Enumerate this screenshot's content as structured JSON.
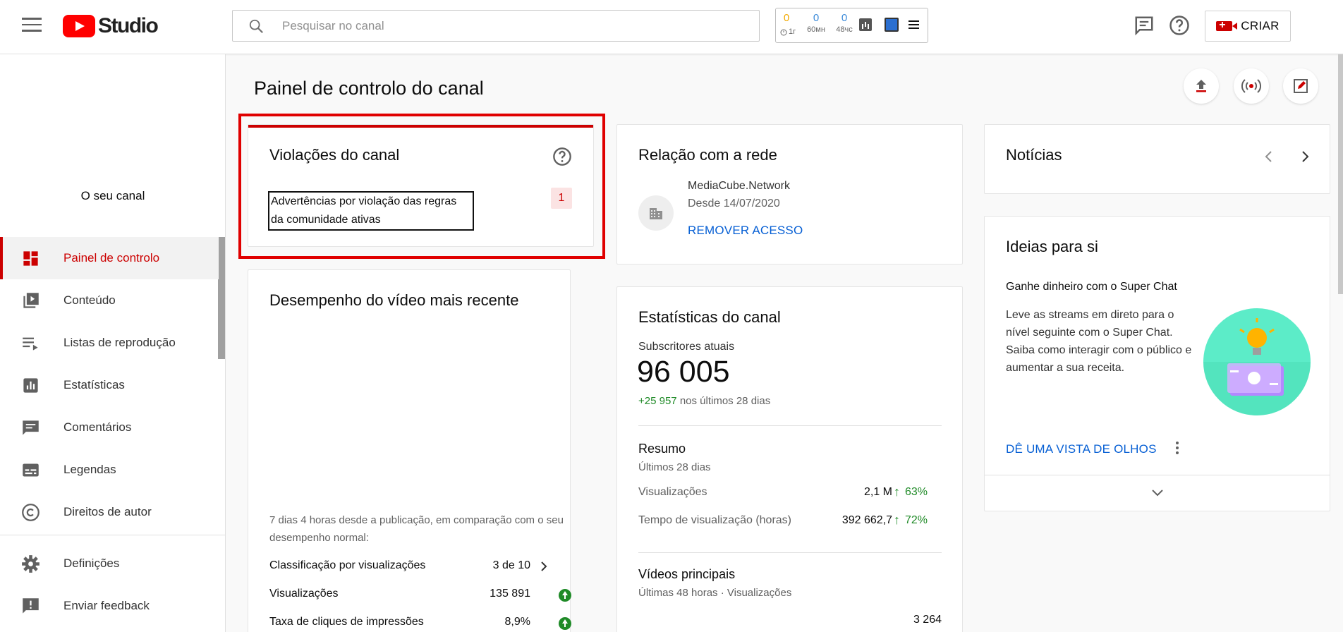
{
  "header": {
    "logo_text": "Studio",
    "search_placeholder": "Pesquisar no canal",
    "extension": {
      "counters": [
        {
          "value": "0",
          "label": "1г",
          "color": "#f2a900"
        },
        {
          "value": "0",
          "label": "60мн",
          "color": "#3b8ad9"
        },
        {
          "value": "0",
          "label": "48чс",
          "color": "#3b8ad9"
        }
      ]
    },
    "create_label": "CRIAR"
  },
  "sidebar": {
    "channel_label": "O seu canal",
    "items": [
      {
        "label": "Painel de controlo",
        "icon": "dashboard-icon",
        "active": true
      },
      {
        "label": "Conteúdo",
        "icon": "content-icon"
      },
      {
        "label": "Listas de reprodução",
        "icon": "playlists-icon"
      },
      {
        "label": "Estatísticas",
        "icon": "analytics-icon"
      },
      {
        "label": "Comentários",
        "icon": "comments-icon"
      },
      {
        "label": "Legendas",
        "icon": "subtitles-icon"
      },
      {
        "label": "Direitos de autor",
        "icon": "copyright-icon"
      },
      {
        "label": "Definições",
        "icon": "gear-icon"
      },
      {
        "label": "Enviar feedback",
        "icon": "feedback-icon"
      }
    ]
  },
  "main": {
    "page_title": "Painel de controlo do canal",
    "violations": {
      "title": "Violações do canal",
      "link_text": "Advertências por violação das regras da comunidade ativas",
      "count": "1"
    },
    "performance": {
      "title": "Desempenho do vídeo mais recente",
      "comparison_text": "7 dias 4 horas desde a publicação, em comparação com o seu desempenho normal:",
      "rows": [
        {
          "label": "Classificação por visualizações",
          "value": "3 de 10"
        },
        {
          "label": "Visualizações",
          "value": "135 891"
        },
        {
          "label": "Taxa de cliques de impressões",
          "value": "8,9%"
        }
      ]
    },
    "network": {
      "title": "Relação com a rede",
      "name": "MediaCube.Network",
      "since": "Desde 14/07/2020",
      "remove_label": "REMOVER ACESSO"
    },
    "stats": {
      "title": "Estatísticas do canal",
      "subs_label": "Subscritores atuais",
      "subs_value": "96 005",
      "subs_delta": "+25 957",
      "subs_delta_suffix": "nos últimos 28 dias",
      "summary_title": "Resumo",
      "summary_period": "Últimos 28 dias",
      "summary_rows": [
        {
          "label": "Visualizações",
          "value": "2,1 M",
          "pct": "63%"
        },
        {
          "label": "Tempo de visualização (horas)",
          "value": "392 662,7",
          "pct": "72%"
        }
      ],
      "top_videos_title": "Vídeos principais",
      "top_videos_period": "Últimas 48 horas · Visualizações",
      "top_video_value": "3 264"
    },
    "news": {
      "title": "Notícias"
    },
    "ideas": {
      "title": "Ideias para si",
      "headline": "Ganhe dinheiro com o Super Chat",
      "body": "Leve as streams em direto para o nível seguinte com o Super Chat. Saiba como interagir com o público e aumentar a sua receita.",
      "cta": "DÊ UMA VISTA DE OLHOS"
    }
  },
  "colors": {
    "accent_red": "#cc0000",
    "link_blue": "#065fd4",
    "positive_green": "#1f8a27"
  }
}
